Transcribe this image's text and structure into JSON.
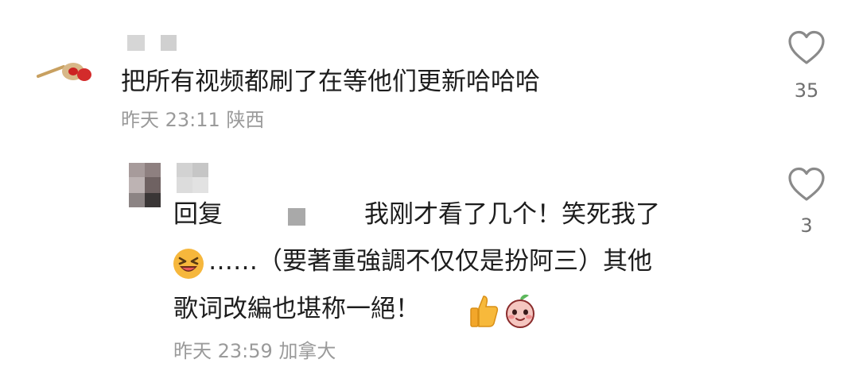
{
  "comments": [
    {
      "text": "把所有视频都刷了在等他们更新哈哈哈",
      "time": "昨天 23:11",
      "location": "陕西",
      "likes": "35"
    }
  ],
  "reply": {
    "prefix": "回复",
    "line1": "我刚才看了几个！笑死我了",
    "line2": "……（要著重強調不仅仅是扮阿三）其他",
    "line3": "歌词改編也堪称一絕！",
    "time": "昨天 23:59",
    "location": "加拿大",
    "likes": "3"
  },
  "icons": {
    "like": "heart-outline-icon",
    "emoji_laugh": "grinning-squint-emoji",
    "emoji_thumbs": "thumbs-up-emoji",
    "emoji_sticker": "peach-sticker-emoji"
  }
}
